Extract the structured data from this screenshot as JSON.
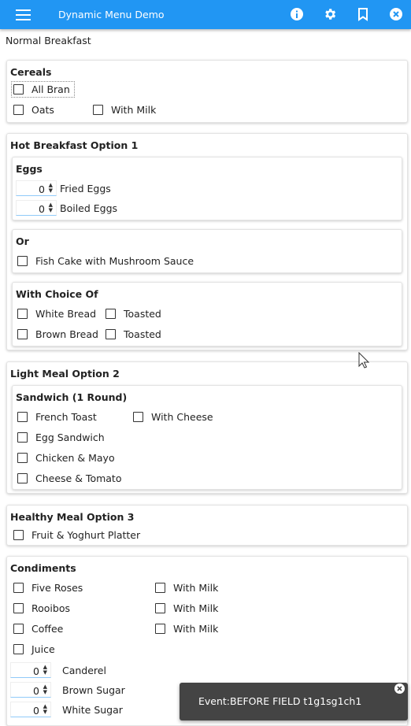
{
  "app": {
    "title": "Dynamic Menu Demo",
    "menu_icon": "hamburger-icon",
    "actions": [
      "info-icon",
      "gear-icon",
      "bookmark-icon",
      "close-icon"
    ],
    "accent": "#2196f3"
  },
  "page": {
    "subtitle": "Normal Breakfast"
  },
  "cereals": {
    "title": "Cereals",
    "all_bran": "All Bran",
    "oats": "Oats",
    "with_milk": "With Milk"
  },
  "hot": {
    "title": "Hot Breakfast Option 1",
    "eggs": {
      "title": "Eggs",
      "fried_value": "0",
      "fried_label": "Fried Eggs",
      "boiled_value": "0",
      "boiled_label": "Boiled Eggs"
    },
    "or": {
      "title": "Or",
      "fish": "Fish Cake with Mushroom Sauce"
    },
    "choice": {
      "title": "With Choice Of",
      "white_bread": "White Bread",
      "toasted1": "Toasted",
      "brown_bread": "Brown Bread",
      "toasted2": "Toasted"
    }
  },
  "light": {
    "title": "Light Meal Option 2",
    "sandwich": {
      "title": "Sandwich (1 Round)",
      "french_toast": "French Toast",
      "with_cheese": "With Cheese",
      "egg": "Egg Sandwich",
      "chicken": "Chicken & Mayo",
      "cheese_tomato": "Cheese & Tomato"
    }
  },
  "healthy": {
    "title": "Healthy Meal Option 3",
    "fruit": "Fruit & Yoghurt Platter"
  },
  "condiments": {
    "title": "Condiments",
    "five_roses": "Five Roses",
    "milk1": "With Milk",
    "rooibos": "Rooibos",
    "milk2": "With Milk",
    "coffee": "Coffee",
    "milk3": "With Milk",
    "juice": "Juice",
    "canderel_value": "0",
    "canderel_label": "Canderel",
    "brown_sugar_value": "0",
    "brown_sugar_label": "Brown Sugar",
    "white_sugar_value": "0",
    "white_sugar_label": "White Sugar"
  },
  "toast": {
    "message": "Event:BEFORE FIELD t1g1sg1ch1"
  }
}
